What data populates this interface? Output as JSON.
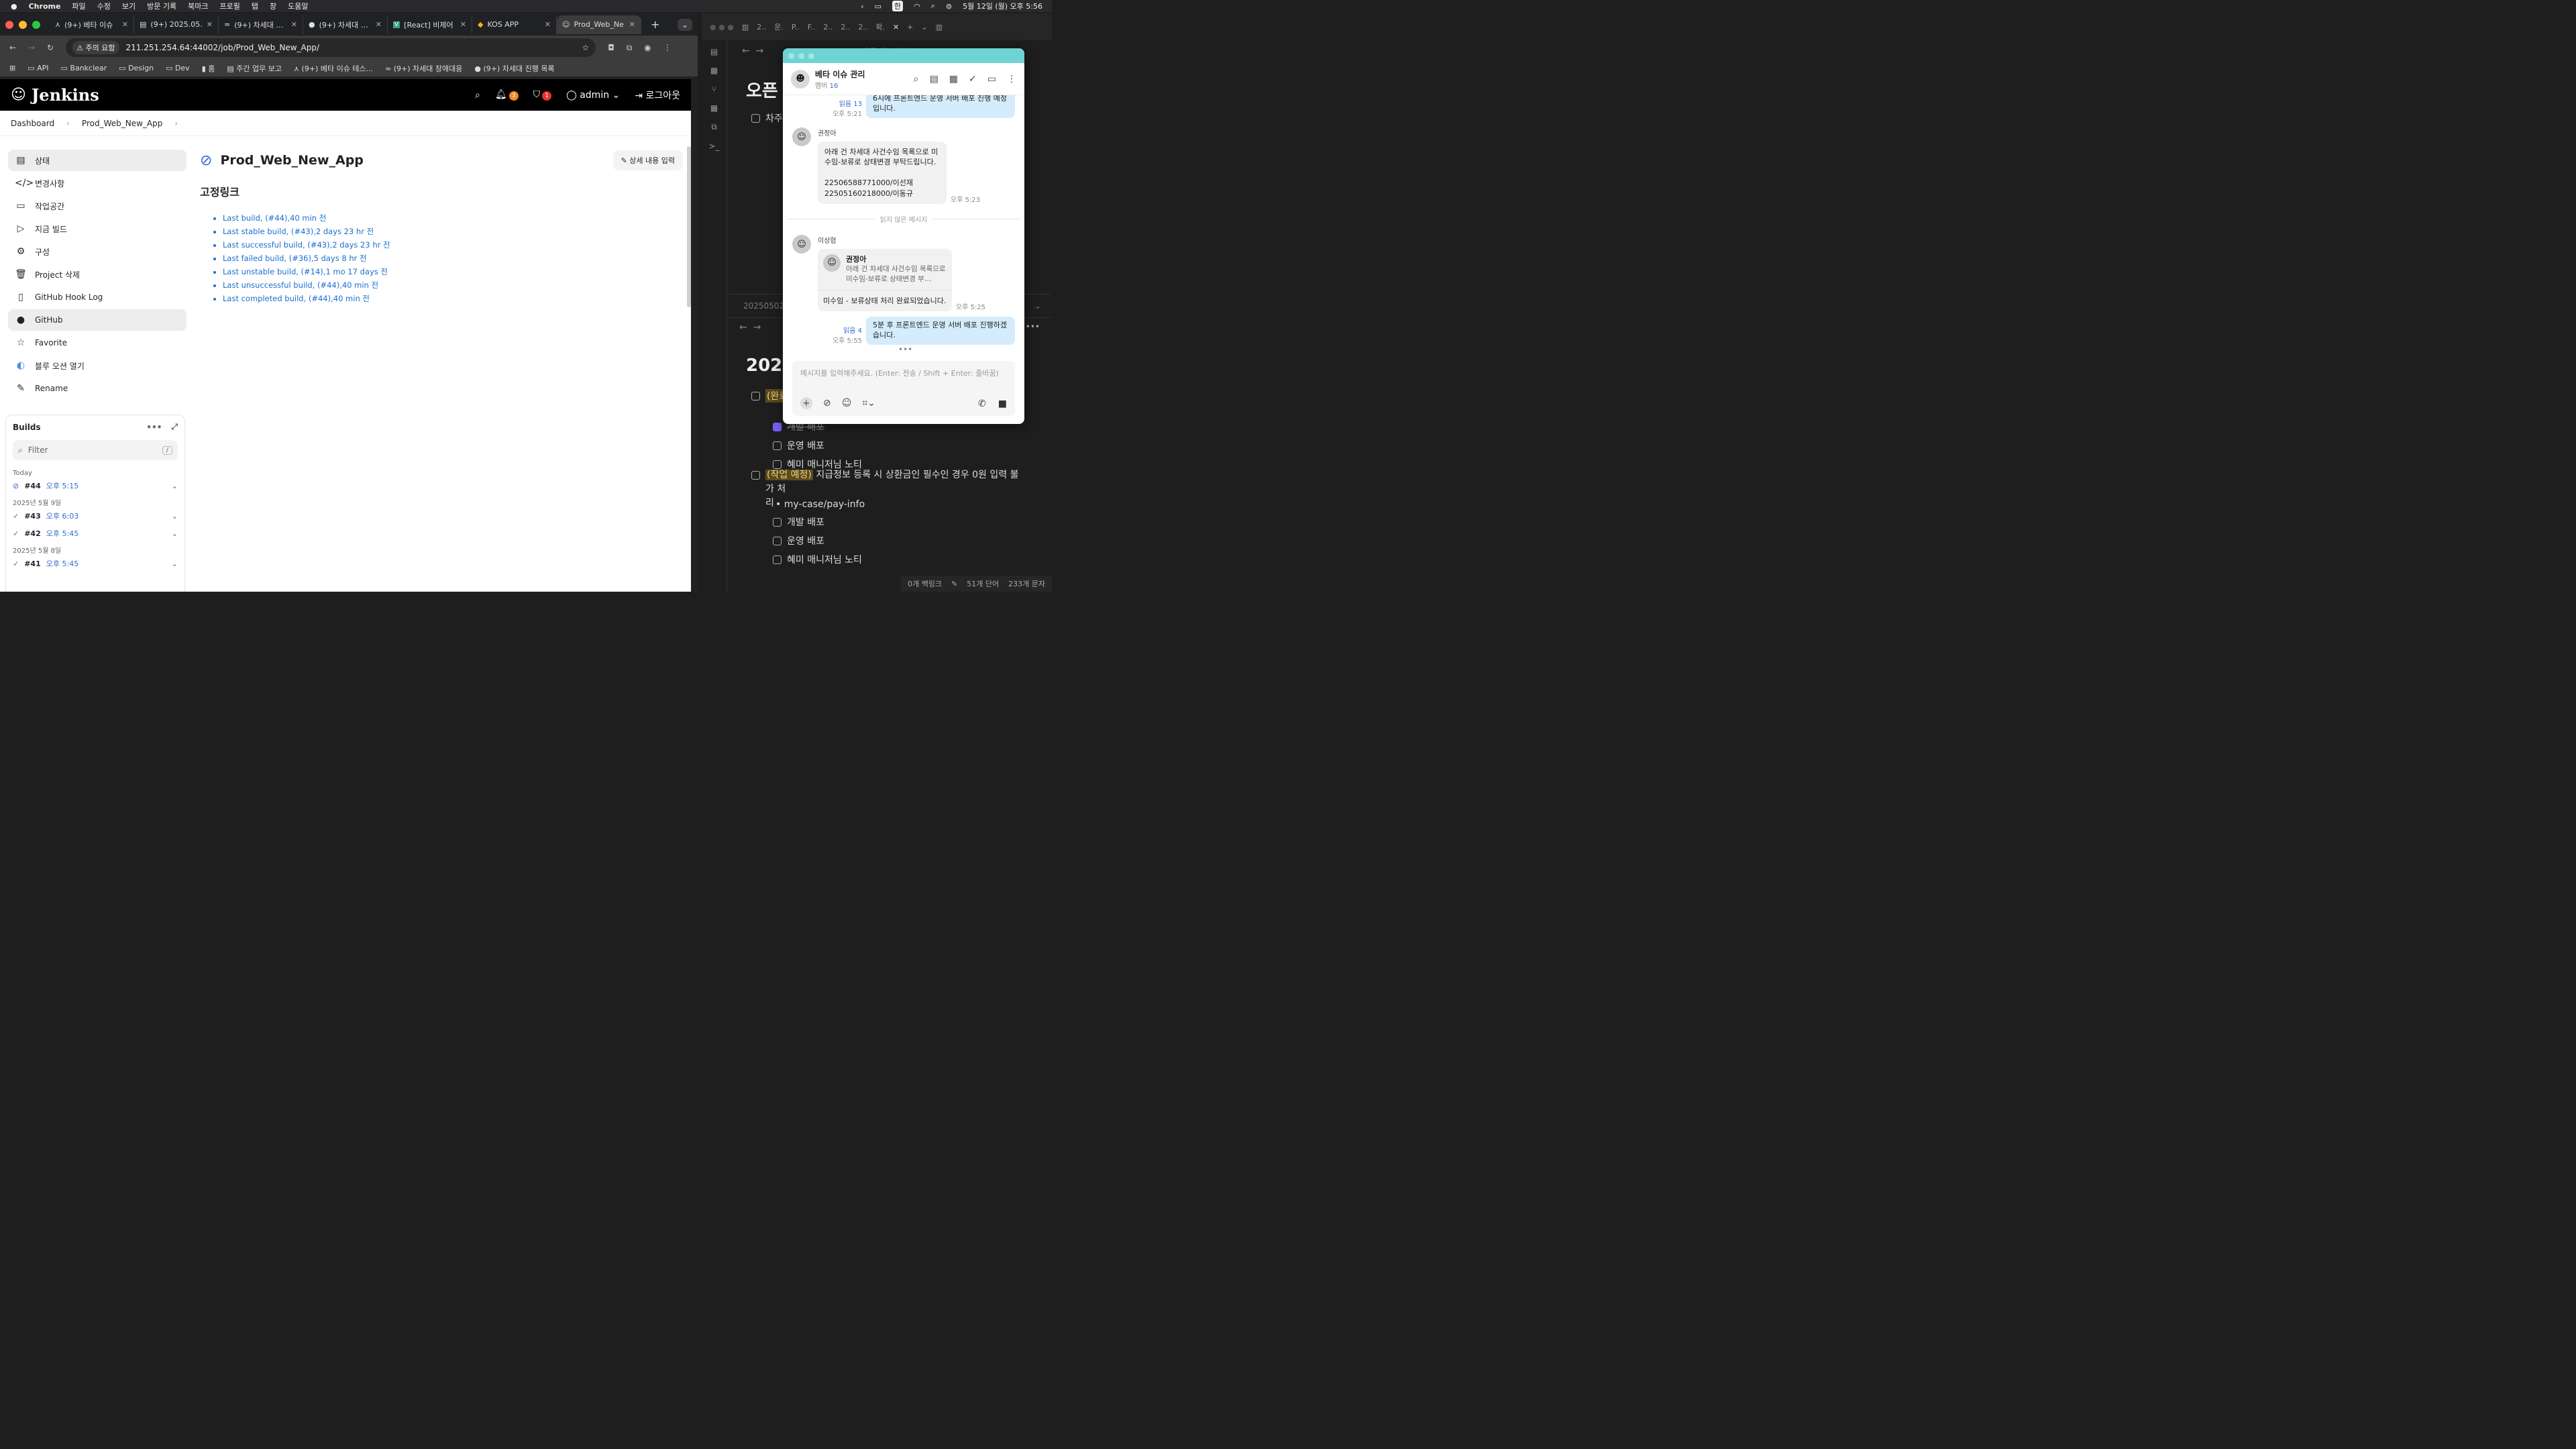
{
  "menubar": {
    "app": "Chrome",
    "items": [
      "파일",
      "수정",
      "보기",
      "방문 기록",
      "북마크",
      "프로필",
      "탭",
      "창",
      "도움말"
    ],
    "clock": "5월 12일 (월) 오후 5:56",
    "input": "한"
  },
  "tabs": [
    {
      "title": "(9+) 베타 이슈 ⁠"
    },
    {
      "title": "(9+) 2025.05."
    },
    {
      "title": "(9+) 차세대 장애"
    },
    {
      "title": "(9+) 차세대 진행"
    },
    {
      "title": "[React] 비제어"
    },
    {
      "title": "KOS APP"
    },
    {
      "title": "Prod_Web_Ne"
    }
  ],
  "address": {
    "warn": "주의 요함",
    "url": "211.251.254.64:44002/job/Prod_Web_New_App/"
  },
  "bookmarks": [
    "API",
    "Bankclear",
    "Design",
    "Dev",
    "홈",
    "주간 업무 보고",
    "(9+) 베타 이슈 테스...",
    "(9+) 차세대 장애대응",
    "(9+) 차세대 진행 목록"
  ],
  "jenkins": {
    "logo": "Jenkins",
    "notif_count": "3",
    "sec_count": "1",
    "user": "admin",
    "logout": "로그아웃",
    "breadcrumb": [
      "Dashboard",
      "Prod_Web_New_App"
    ],
    "side": [
      "상태",
      "변경사항",
      "작업공간",
      "지금 빌드",
      "구성",
      "Project 삭제",
      "GitHub Hook Log",
      "GitHub",
      "Favorite",
      "블루 오션 열기",
      "Rename"
    ],
    "title": "Prod_Web_New_App",
    "edit_btn": "상세 내용 입력",
    "section": "고정링크",
    "links": [
      "Last build, (#44),40 min 전",
      "Last stable build, (#43),2 days 23 hr 전",
      "Last successful build, (#43),2 days 23 hr 전",
      "Last failed build, (#36),5 days 8 hr 전",
      "Last unstable build, (#14),1 mo 17 days 전",
      "Last unsuccessful build, (#44),40 min 전",
      "Last completed build, (#44),40 min 전"
    ],
    "builds": {
      "title": "Builds",
      "filter": "Filter",
      "slash": "/",
      "groups": [
        {
          "date": "Today",
          "items": [
            {
              "num": "#44",
              "time": "오후 5:15"
            }
          ]
        },
        {
          "date": "2025년 5월 9일",
          "items": [
            {
              "num": "#43",
              "time": "오후 6:03"
            },
            {
              "num": "#42",
              "time": "오후 5:45"
            }
          ]
        },
        {
          "date": "2025년 5월 8일",
          "items": [
            {
              "num": "#41",
              "time": "오후 5:45"
            }
          ]
        }
      ]
    }
  },
  "notes": {
    "title_partial": "오픈 체",
    "item1": "차주",
    "date_partial": "20250502",
    "heading": "2025",
    "done_tag": "(완료",
    "subs1": [
      "개발 배포",
      "운영 배포",
      "혜미 매니저님 노티"
    ],
    "task_tag": "(작업 예정)",
    "task": "지급정보 등록 시 상환금인 필수인 경우 0원 입력 불가 처",
    "task2": "리",
    "path": "my-case/pay-info",
    "subs2": [
      "개발 배포",
      "운영 배포",
      "혜미 매니저님 노티"
    ],
    "status": {
      "backlinks": "0개 백링크",
      "words": "51개 단어",
      "chars": "233개 문자"
    },
    "tabs": [
      "2..",
      "운.",
      "P..",
      "F..",
      "2..",
      "2..",
      "2..",
      "확."
    ],
    "top_title": "오픈 체크 리스트"
  },
  "chat": {
    "title": "베타 이슈 관리",
    "members_label": "멤버",
    "members": "16",
    "m1": {
      "text": "6시에 프론트엔드 운영 서버 배포 진행 예정입니다.",
      "read": "읽음 13",
      "time": "오후 5:21"
    },
    "m2": {
      "name": "권정아",
      "text": "아래 건 차세대 사건수임 목록으로 미수임-보류로 상태변경 부탁드립니다.",
      "l1": "22506588771000/이선재",
      "l2": "22505160218000/이동규",
      "time": "오후 5:23"
    },
    "unread": "읽지 않은 메시지",
    "m3": {
      "name": "이상협",
      "quote_name": "권정아",
      "quote": "아래 건 차세대 사건수임 목록으로 미수임-보류로 상태변경 부…",
      "text": "미수임 - 보류상태 처리 완료되었습니다.",
      "time": "오후 5:25"
    },
    "m4": {
      "text": "5분 후 프론트엔드 운영 서버 배포 진행하겠습니다.",
      "read": "읽음 4",
      "time": "오후 5:55"
    },
    "placeholder": "메시지를 입력해주세요. (Enter: 전송 / Shift + Enter: 줄바꿈)"
  }
}
